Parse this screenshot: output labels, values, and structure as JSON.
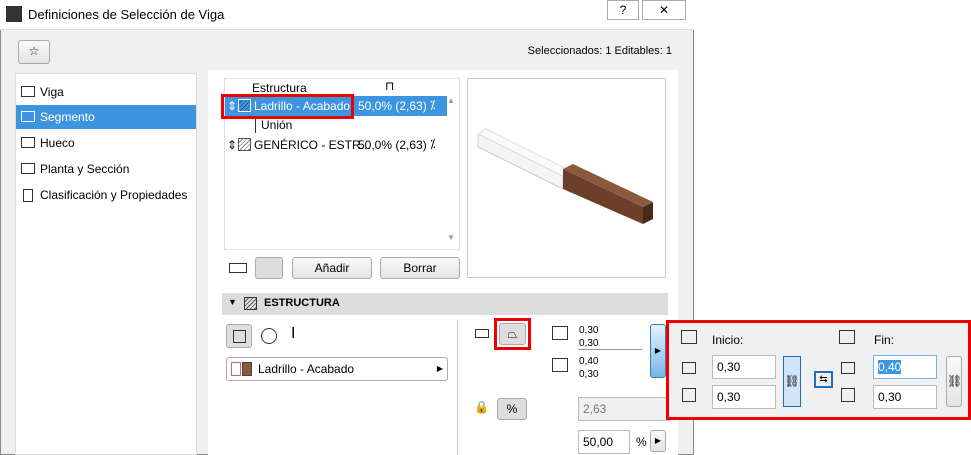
{
  "window": {
    "title": "Definiciones de Selección de Viga",
    "help": "?",
    "close": "✕",
    "status": "Seleccionados: 1 Editables: 1"
  },
  "sidebar": {
    "items": [
      {
        "label": "Viga"
      },
      {
        "label": "Segmento"
      },
      {
        "label": "Hueco"
      },
      {
        "label": "Planta y Sección"
      },
      {
        "label": "Clasificación y Propiedades"
      }
    ]
  },
  "list": {
    "header": "Estructura",
    "rows": [
      {
        "name": "Ladrillo - Acabado",
        "value": "50,0% (2,63)"
      },
      {
        "name": "Unión"
      },
      {
        "name": "GENÉRICO - ESTR...",
        "value": "50,0% (2,63)"
      }
    ],
    "add": "Añadir",
    "delete": "Borrar"
  },
  "section": {
    "title": "ESTRUCTURA",
    "material": "Ladrillo - Acabado"
  },
  "dims": {
    "start_h": "0,30",
    "start_w": "0,30",
    "end_h": "0,40",
    "end_w": "0,30",
    "length": "2,63",
    "percent": "50,00",
    "percent_unit": "%"
  },
  "popup": {
    "start_label": "Inicio:",
    "end_label": "Fin:",
    "start_h": "0,30",
    "start_w": "0,30",
    "end_h": "0,40",
    "end_w": "0,30"
  },
  "colors": {
    "accent": "#3d95e0",
    "highlight": "#e00000"
  }
}
